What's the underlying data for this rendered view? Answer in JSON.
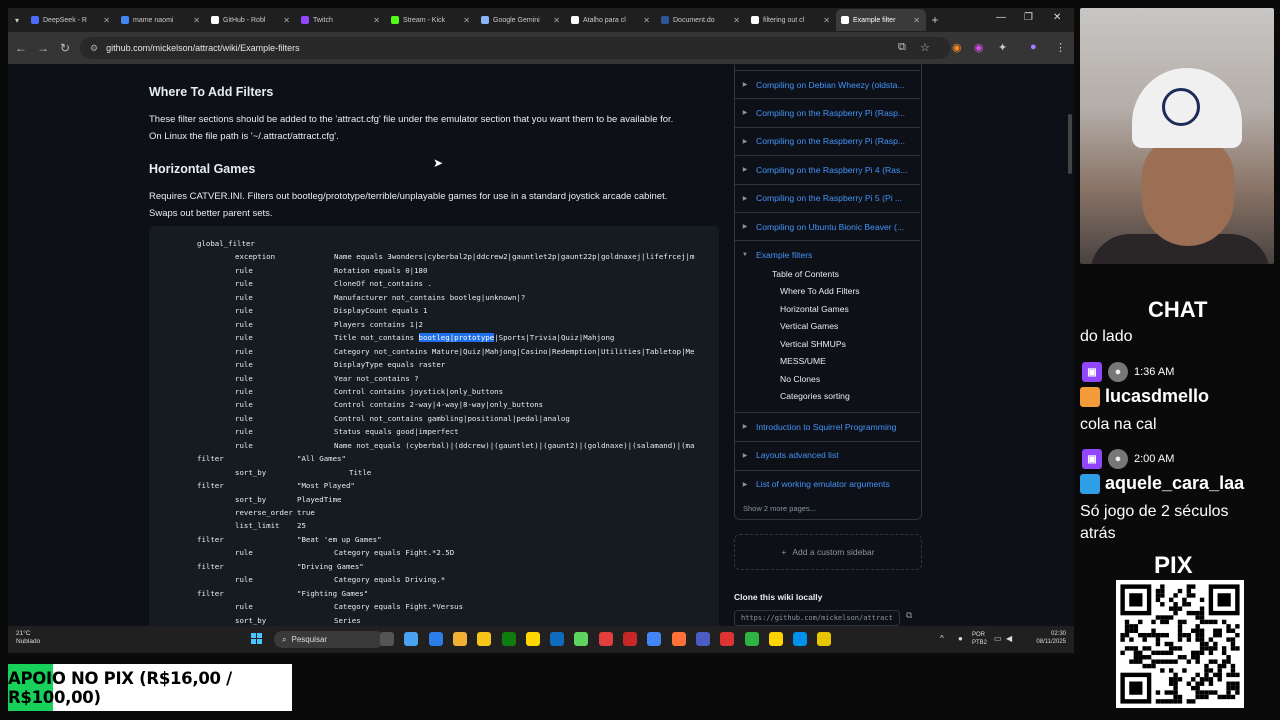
{
  "browser": {
    "tabs": [
      {
        "label": "DeepSeek - R",
        "color": "#4d6bfe"
      },
      {
        "label": "mame naomi",
        "color": "#4285f4"
      },
      {
        "label": "GitHub - Robl",
        "color": "#ffffff"
      },
      {
        "label": "Twitch",
        "color": "#9146ff"
      },
      {
        "label": "Stream - Kick",
        "color": "#53fc18"
      },
      {
        "label": "Google Gemini",
        "color": "#8ab4f8"
      },
      {
        "label": "Atalho para cl",
        "color": "#ffffff"
      },
      {
        "label": "Document.do",
        "color": "#2b579a"
      },
      {
        "label": "filtering out cl",
        "color": "#ffffff"
      },
      {
        "label": "Example filter",
        "color": "#ffffff"
      }
    ],
    "url": "github.com/mickelson/attract/wiki/Example-filters"
  },
  "content": {
    "where_heading": "Where To Add Filters",
    "where_text_1": "These filter sections should be added to the 'attract.cfg' file under the emulator section that you want them to be available for.",
    "where_text_2": "On Linux the file path is '~/.attract/attract.cfg'.",
    "horizontal_heading": "Horizontal Games",
    "horizontal_text_1": "Requires CATVER.INI. Filters out bootleg/prototype/terrible/unplayable games for use in a standard joystick arcade cabinet.",
    "horizontal_text_2": "Swaps out better parent sets.",
    "code": [
      {
        "a": "global_filter",
        "b": "",
        "c": "",
        "indent": 0
      },
      {
        "a": "exception",
        "b": "",
        "c": "Name equals 3wonders|cyberbal2p|ddcrew2|gauntlet2p|gaunt22p|goldnaxej|lifefrcej|m",
        "indent": 1
      },
      {
        "a": "rule",
        "b": "",
        "c": "Rotation equals 0|180",
        "indent": 1
      },
      {
        "a": "rule",
        "b": "",
        "c": "CloneOf not_contains .",
        "indent": 1
      },
      {
        "a": "rule",
        "b": "",
        "c": "Manufacturer not_contains bootleg|unknown|?",
        "indent": 1
      },
      {
        "a": "rule",
        "b": "",
        "c": "DisplayCount equals 1",
        "indent": 1
      },
      {
        "a": "rule",
        "b": "",
        "c": "Players contains 1|2",
        "indent": 1
      },
      {
        "a": "rule",
        "b": "",
        "c": "Title not_contains ",
        "hl": "bootleg|prototype",
        "c2": "|Sports|Trivia|Quiz|Mahjong",
        "indent": 1
      },
      {
        "a": "rule",
        "b": "",
        "c": "Category not_contains Mature|Quiz|Mahjong|Casino|Redemption|Utilities|Tabletop|Me",
        "indent": 1
      },
      {
        "a": "rule",
        "b": "",
        "c": "DisplayType equals raster",
        "indent": 1
      },
      {
        "a": "rule",
        "b": "",
        "c": "Year not_contains ?",
        "indent": 1
      },
      {
        "a": "rule",
        "b": "",
        "c": "Control contains joystick|only_buttons",
        "indent": 1
      },
      {
        "a": "rule",
        "b": "",
        "c": "Control contains 2-way|4-way|8-way|only_buttons",
        "indent": 1
      },
      {
        "a": "rule",
        "b": "",
        "c": "Control not_contains gambling|positional|pedal|analog",
        "indent": 1
      },
      {
        "a": "rule",
        "b": "",
        "c": "Status equals good|imperfect",
        "indent": 1
      },
      {
        "a": "rule",
        "b": "",
        "c": "Name not_equals (cyberbal)|(ddcrew)|(gauntlet)|(gaunt2)|(goldnaxe)|(salamand)|(ma",
        "indent": 1
      },
      {
        "a": "filter",
        "b": "\"All Games\"",
        "c": "",
        "indent": 0
      },
      {
        "a": "sort_by",
        "b": "",
        "c": "Title",
        "indent": 1,
        "mid": true
      },
      {
        "a": "filter",
        "b": "\"Most Played\"",
        "c": "",
        "indent": 0
      },
      {
        "a": "sort_by",
        "b": "PlayedTime",
        "c": "",
        "indent": 1
      },
      {
        "a": "reverse_order",
        "b": "true",
        "c": "",
        "indent": 1
      },
      {
        "a": "list_limit",
        "b": "25",
        "c": "",
        "indent": 1
      },
      {
        "a": "filter",
        "b": "\"Beat 'em up Games\"",
        "c": "",
        "indent": 0
      },
      {
        "a": "rule",
        "b": "",
        "c": "Category equals Fight.*2.5D",
        "indent": 1
      },
      {
        "a": "filter",
        "b": "\"Driving Games\"",
        "c": "",
        "indent": 0
      },
      {
        "a": "rule",
        "b": "",
        "c": "Category equals Driving.*",
        "indent": 1
      },
      {
        "a": "filter",
        "b": "\"Fighting Games\"",
        "c": "",
        "indent": 0
      },
      {
        "a": "rule",
        "b": "",
        "c": "Category equals Fight.*Versus",
        "indent": 1
      },
      {
        "a": "sort_by",
        "b": "",
        "c": "Series",
        "indent": 1
      }
    ]
  },
  "sidebar": {
    "pages": [
      "Compiling on Debian Wheezy (oldsta...",
      "Compiling on the Raspberry Pi (Rasp...",
      "Compiling on the Raspberry Pi (Rasp...",
      "Compiling on the Raspberry Pi 4 (Ras...",
      "Compiling on the Raspberry Pi 5 (Pi ...",
      "Compiling on Ubuntu Bionic Beaver (..."
    ],
    "current_page": "Example filters",
    "toc_title": "Table of Contents",
    "toc": [
      "Where To Add Filters",
      "Horizontal Games",
      "Vertical Games",
      "Vertical SHMUPs",
      "MESS/UME",
      "No Clones",
      "Categories sorting"
    ],
    "more_pages": [
      "Introduction to Squirrel Programming",
      "Layouts advanced list",
      "List of working emulator arguments"
    ],
    "show_more": "Show 2 more pages...",
    "add_sidebar": "Add a custom sidebar",
    "clone_title": "Clone this wiki locally",
    "clone_url": "https://github.com/mickelson/attract"
  },
  "taskbar": {
    "temp": "21°C",
    "weather": "Nublado",
    "search": "Pesquisar",
    "lang": "POR",
    "lang2": "PTB2",
    "time": "02:30",
    "date": "08/11/2025"
  },
  "stream": {
    "chat_title": "CHAT",
    "chat_lines": [
      {
        "kind": "text",
        "text": "do lado"
      },
      {
        "kind": "meta",
        "time": "1:36 AM"
      },
      {
        "kind": "name",
        "name": "lucasdmello"
      },
      {
        "kind": "text",
        "text": "cola na cal"
      },
      {
        "kind": "meta",
        "time": "2:00 AM"
      },
      {
        "kind": "name",
        "name": "aquele_cara_laa"
      },
      {
        "kind": "text",
        "text": "Só jogo de 2 séculos"
      },
      {
        "kind": "text",
        "text": "atrás"
      }
    ],
    "pix_title": "PIX",
    "apoio": "APOIO NO PIX (R$16,00 / R$100,00)",
    "apoio_progress": 0.16
  }
}
